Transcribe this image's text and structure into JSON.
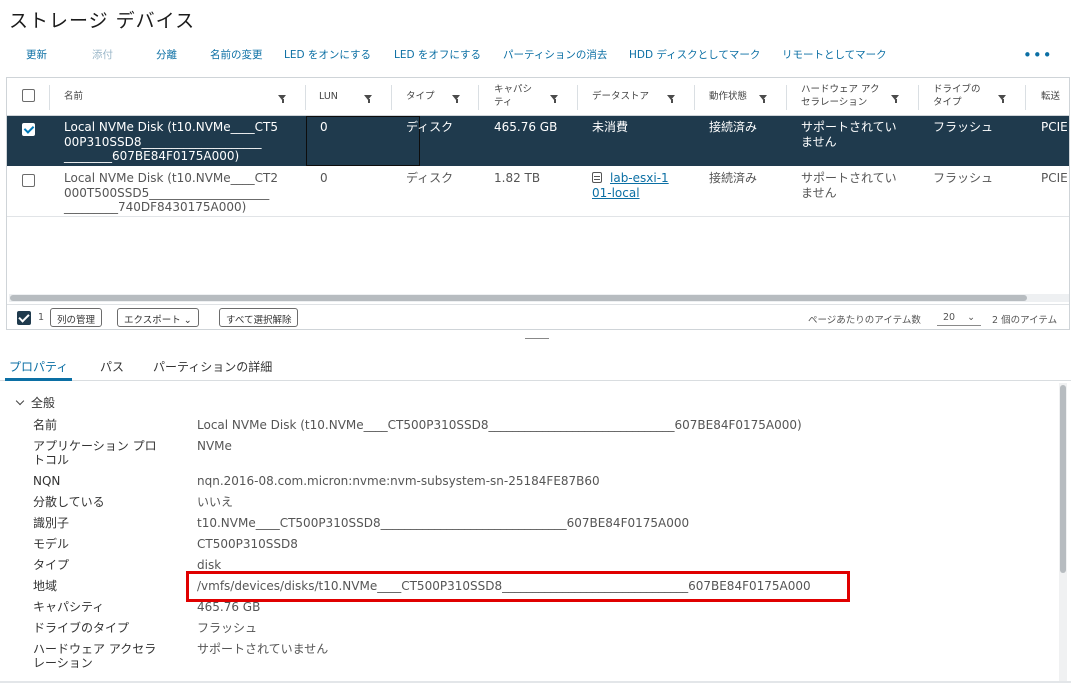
{
  "page": {
    "title": "ストレージ デバイス"
  },
  "toolbar": {
    "refresh": "更新",
    "attach": "添付",
    "detach": "分離",
    "rename": "名前の変更",
    "led_on": "LED をオンにする",
    "led_off": "LED をオフにする",
    "erase_partitions": "パーティションの消去",
    "mark_hdd": "HDD ディスクとしてマーク",
    "mark_remote": "リモートとしてマーク",
    "more": "•••"
  },
  "grid": {
    "columns": {
      "name": "名前",
      "lun": "LUN",
      "type": "タイプ",
      "capacity_l1": "キャパシ",
      "capacity_l2": "ティ",
      "datastore": "データストア",
      "operational_state": "動作状態",
      "hw_accel_l1": "ハードウェア アク",
      "hw_accel_l2": "セラレーション",
      "drive_type_l1": "ドライブの",
      "drive_type_l2": "タイプ",
      "transport": "転送"
    },
    "rows": [
      {
        "name_l1": "Local NVMe Disk (t10.NVMe____CT5",
        "name_l2": "00P310SSD8____________________",
        "name_l3": "________607BE84F0175A000)",
        "lun": "0",
        "type": "ディスク",
        "capacity": "465.76 GB",
        "datastore": "未消費",
        "state": "接続済み",
        "hw_accel_l1": "サポートされてい",
        "hw_accel_l2": "ません",
        "drive_type": "フラッシュ",
        "transport": "PCIE"
      },
      {
        "name_l1": "Local NVMe Disk (t10.NVMe____CT2",
        "name_l2": "000T500SSD5____________________",
        "name_l3": "_________740DF8430175A000)",
        "lun": "0",
        "type": "ディスク",
        "capacity": "1.82 TB",
        "datastore_l1": "lab-esxi-1",
        "datastore_l2": "01-local",
        "state": "接続済み",
        "hw_accel_l1": "サポートされてい",
        "hw_accel_l2": "ません",
        "drive_type": "フラッシュ",
        "transport": "PCIE"
      }
    ],
    "footer": {
      "selected_count": "1",
      "manage_columns": "列の管理",
      "export": "エクスポート ⌄",
      "deselect_all": "すべて選択解除",
      "items_per_page_label": "ページあたりのアイテム数",
      "page_size": "20",
      "page_size_chevron": "⌄",
      "item_count": "2 個のアイテム"
    }
  },
  "tabs": {
    "properties": "プロパティ",
    "paths": "パス",
    "partition_details": "パーティションの詳細"
  },
  "properties": {
    "section": "全般",
    "items": [
      {
        "key": "名前",
        "value": "Local NVMe Disk (t10.NVMe____CT500P310SSD8_______________________________607BE84F0175A000)"
      },
      {
        "key_l1": "アプリケーション プロ",
        "key_l2": "トコル",
        "value": "NVMe"
      },
      {
        "key": "NQN",
        "value": "nqn.2016-08.com.micron:nvme:nvm-subsystem-sn-25184FE87B60"
      },
      {
        "key": "分散している",
        "value": "いいえ"
      },
      {
        "key": "識別子",
        "value": "t10.NVMe____CT500P310SSD8_______________________________607BE84F0175A000"
      },
      {
        "key": "モデル",
        "value": "CT500P310SSD8"
      },
      {
        "key": "タイプ",
        "value": "disk"
      },
      {
        "key": "地域",
        "value": "/vmfs/devices/disks/t10.NVMe____CT500P310SSD8_______________________________607BE84F0175A000"
      },
      {
        "key": "キャパシティ",
        "value": "465.76 GB"
      },
      {
        "key": "ドライブのタイプ",
        "value": "フラッシュ"
      },
      {
        "key_l1": "ハードウェア アクセラ",
        "key_l2": "レーション",
        "value": "サポートされていません"
      }
    ]
  },
  "colors": {
    "accent": "#0b6fa4",
    "selected_row": "#1f3a4d",
    "highlight": "#e00000"
  }
}
